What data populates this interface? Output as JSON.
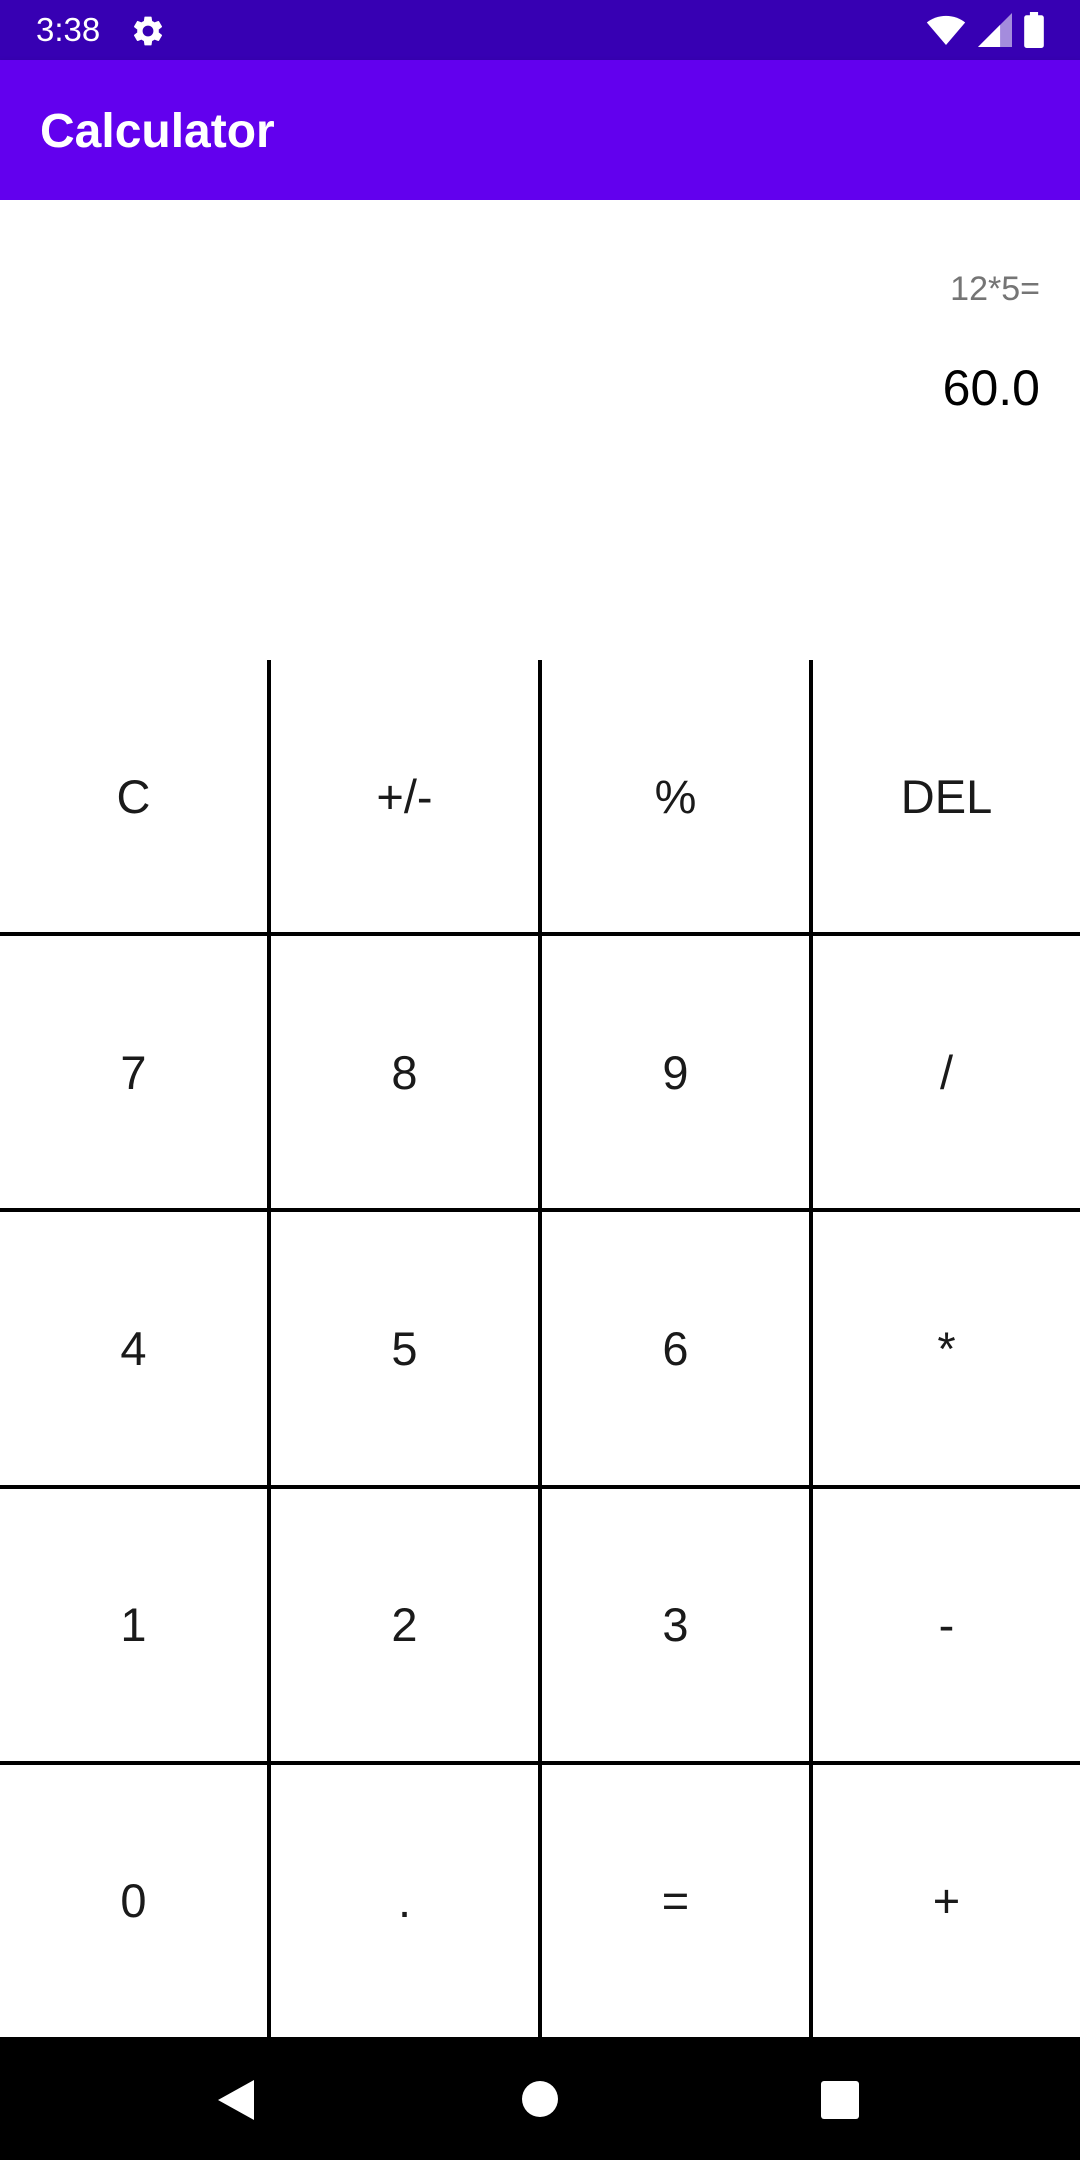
{
  "status_bar": {
    "time": "3:38",
    "icons": [
      "gear-icon",
      "wifi-icon",
      "cell-signal-icon",
      "battery-icon"
    ]
  },
  "app_bar": {
    "title": "Calculator"
  },
  "display": {
    "expression": "12*5=",
    "result": "60.0"
  },
  "keypad": {
    "keys": [
      "C",
      "+/-",
      "%",
      "DEL",
      "7",
      "8",
      "9",
      "/",
      "4",
      "5",
      "6",
      "*",
      "1",
      "2",
      "3",
      "-",
      "0",
      ".",
      "=",
      "+"
    ]
  },
  "nav_bar": {
    "icons": [
      "back-icon",
      "home-icon",
      "recents-icon"
    ]
  },
  "colors": {
    "status_bar": "#3700b3",
    "app_bar": "#6200ee",
    "expression_text": "#757575",
    "key_border": "#000000"
  }
}
